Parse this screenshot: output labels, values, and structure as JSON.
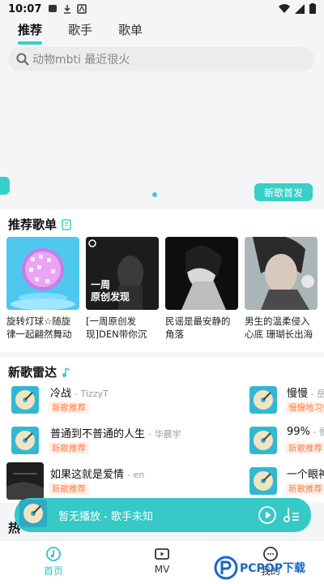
{
  "status_bar": {
    "time": "10:07"
  },
  "top_tabs": [
    {
      "label": "推荐",
      "active": true
    },
    {
      "label": "歌手",
      "active": false
    },
    {
      "label": "歌单",
      "active": false
    }
  ],
  "search": {
    "placeholder": "动物mbti 最近很火"
  },
  "banner": {
    "badge": "新歌首发"
  },
  "playlists": {
    "title": "推荐歌单",
    "items": [
      {
        "title": "旋转灯球☆随旋律一起翩然舞动"
      },
      {
        "title": "[一周原创发现]DEN带你沉入...",
        "cover_text": "一周\n原创发现"
      },
      {
        "title": "民谣是最安静的角落"
      },
      {
        "title": "男生的温柔侵入心底 珊瑚长出海面..."
      }
    ]
  },
  "new_songs": {
    "title": "新歌雷达",
    "left": [
      {
        "name": "冷战",
        "artist": "TizzyT",
        "tag": "新歌推荐"
      },
      {
        "name": "普通到不普通的人生",
        "artist": "华晨宇",
        "tag": "新歌推荐"
      },
      {
        "name": "如果这就是爱情",
        "artist": "en",
        "tag": "新歌推荐"
      }
    ],
    "right": [
      {
        "name": "慢慢",
        "artist": "岳",
        "tag": "慢慢地习惯"
      },
      {
        "name": "99%",
        "artist": "侯",
        "tag": "新歌推荐"
      },
      {
        "name": "一个眼神",
        "artist": "",
        "tag": "新歌推荐"
      }
    ]
  },
  "player": {
    "text": "暂无播放 - 歌手未知"
  },
  "partial_section_title": "热",
  "bottom_nav": [
    {
      "label": "首页",
      "active": true
    },
    {
      "label": "MV",
      "active": false
    },
    {
      "label": "我的",
      "active": false
    }
  ],
  "watermark": {
    "text": "PCPOP下载"
  },
  "colors": {
    "accent": "#35d0c6",
    "tag_orange": "#ff7a45"
  }
}
